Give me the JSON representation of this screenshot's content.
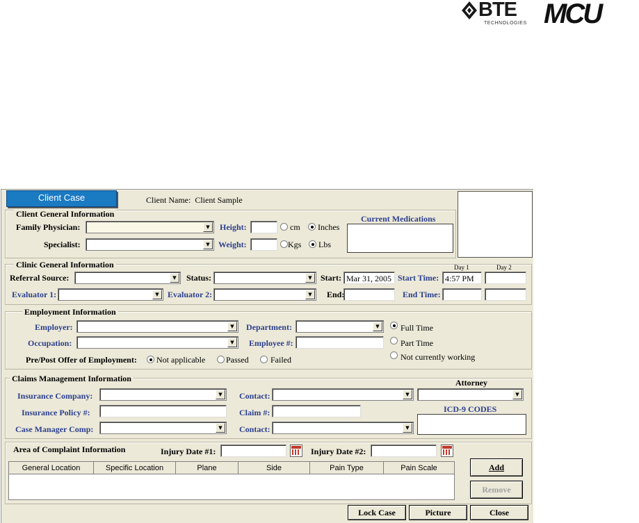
{
  "logos": {
    "bte_word": "BTE",
    "bte_sub": "TECHNOLOGIES",
    "mcu": "MCU"
  },
  "tab_label": "Client Case",
  "client_name": {
    "label": "Client Name:",
    "value": "Client Sample"
  },
  "client_general": {
    "legend": "Client General Information",
    "family_physician_label": "Family Physician:",
    "specialist_label": "Specialist:",
    "height_label": "Height:",
    "weight_label": "Weight:",
    "cm_label": "cm",
    "inches_label": "Inches",
    "kgs_label": "Kgs",
    "lbs_label": "Lbs",
    "height_unit_selected": "Inches",
    "weight_unit_selected": "Lbs",
    "current_medications_label": "Current Medications"
  },
  "clinic_general": {
    "legend": "Clinic General Information",
    "referral_label": "Referral Source:",
    "status_label": "Status:",
    "start_label": "Start:",
    "start_value": "Mar 31, 2005",
    "start_time_label": "Start Time:",
    "day1_label": "Day 1",
    "day2_label": "Day 2",
    "start_time_value": "4:57 PM",
    "evaluator1_label": "Evaluator 1:",
    "evaluator2_label": "Evaluator 2:",
    "end_label": "End:",
    "end_time_label": "End Time:"
  },
  "employment": {
    "legend": "Employment Information",
    "employer_label": "Employer:",
    "department_label": "Department:",
    "occupation_label": "Occupation:",
    "employee_no_label": "Employee #:",
    "full_time_label": "Full Time",
    "part_time_label": "Part Time",
    "not_working_label": "Not currently working",
    "status_selected": "Full Time",
    "offer_label": "Pre/Post Offer of Employment:",
    "not_applicable_label": "Not applicable",
    "passed_label": "Passed",
    "failed_label": "Failed",
    "offer_selected": "Not applicable"
  },
  "claims": {
    "legend": "Claims Management Information",
    "insurance_company_label": "Insurance Company:",
    "insurance_policy_label": "Insurance Policy #:",
    "case_manager_label": "Case Manager Comp:",
    "contact_label": "Contact:",
    "claim_label": "Claim #:",
    "contact2_label": "Contact:",
    "attorney_label": "Attorney",
    "icd9_label": "ICD-9 CODES"
  },
  "complaint": {
    "legend": "Area of Complaint  Information",
    "injury1_label": "Injury Date #1:",
    "injury2_label": "Injury Date #2:",
    "columns": [
      "General Location",
      "Specific Location",
      "Plane",
      "Side",
      "Pain Type",
      "Pain Scale"
    ],
    "add_label": "Add",
    "remove_label": "Remove"
  },
  "buttons": {
    "lock_case": "Lock Case",
    "picture": "Picture",
    "close": "Close"
  }
}
